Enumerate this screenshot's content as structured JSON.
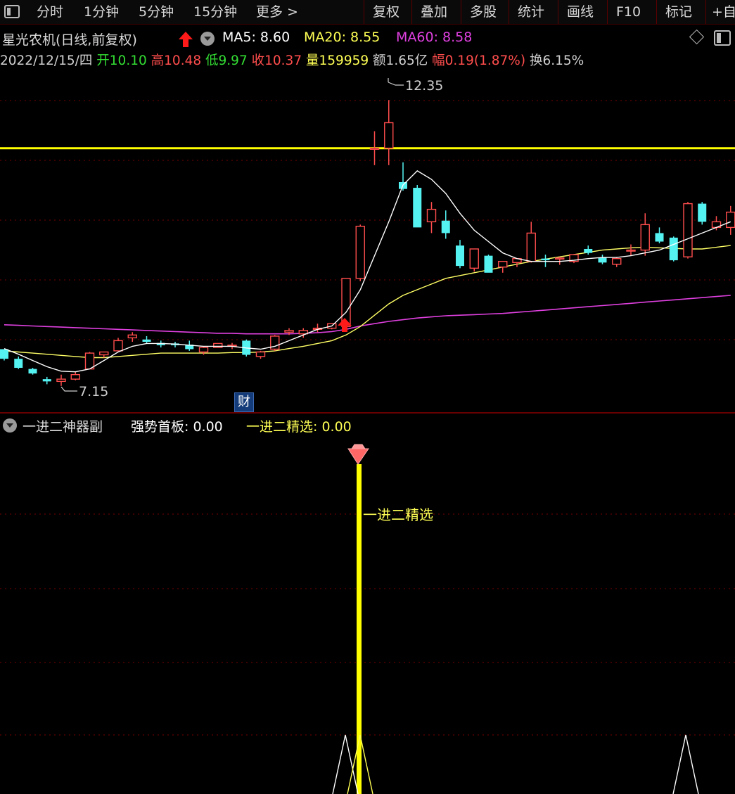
{
  "toolbar": {
    "timeframes": [
      "分时",
      "1分钟",
      "5分钟",
      "15分钟",
      "更多 >"
    ],
    "buttons": [
      "复权",
      "叠加",
      "多股",
      "统计",
      "画线",
      "F10",
      "标记",
      "+自"
    ]
  },
  "header": {
    "stock_title": "星光农机(日线,前复权)",
    "ma5_label": "MA5: 8.60",
    "ma20_label": "MA20: 8.55",
    "ma60_label": "MA60: 8.58"
  },
  "quote": {
    "date": "2022/12/15/四",
    "open_label": "开",
    "open": "10.10",
    "high_label": "高",
    "high": "10.48",
    "low_label": "低",
    "low": "9.97",
    "close_label": "收",
    "close": "10.37",
    "volume_label": "量",
    "volume": "159959",
    "amount_label": "额",
    "amount": "1.65亿",
    "change_label": "幅",
    "change": "0.19(1.87%)",
    "turnover_label": "换",
    "turnover": "6.15%"
  },
  "main_chart": {
    "high_annotation": "12.35",
    "low_annotation": "7.15",
    "finance_badge": "财",
    "resistance_price": 11.5
  },
  "indicator": {
    "name": "一进二神器副",
    "strong_label": "强势首板: 0.00",
    "select_label": "一进二精选: 0.00",
    "bar_label": "一进二精选"
  },
  "chart_data": {
    "type": "candlestick",
    "ohlc": [
      [
        7.95,
        7.9,
        7.78,
        7.75
      ],
      [
        7.78,
        7.82,
        7.62,
        7.6
      ],
      [
        7.6,
        7.62,
        7.52,
        7.5
      ],
      [
        7.42,
        7.46,
        7.38,
        7.33
      ],
      [
        7.38,
        7.5,
        7.42,
        7.3
      ],
      [
        7.42,
        7.55,
        7.5,
        7.4
      ],
      [
        7.6,
        7.9,
        7.88,
        7.6
      ],
      [
        7.85,
        7.9,
        7.9,
        7.8
      ],
      [
        7.92,
        8.15,
        8.1,
        7.92
      ],
      [
        8.15,
        8.25,
        8.2,
        8.08
      ],
      [
        8.12,
        8.18,
        8.08,
        8.05
      ],
      [
        8.06,
        8.1,
        8.02,
        7.98
      ],
      [
        8.05,
        8.08,
        8.02,
        7.98
      ],
      [
        8.03,
        8.1,
        7.95,
        7.92
      ],
      [
        7.9,
        8.0,
        7.98,
        7.85
      ],
      [
        7.98,
        8.05,
        8.05,
        7.98
      ],
      [
        8.02,
        8.06,
        8.02,
        7.95
      ],
      [
        8.1,
        8.12,
        7.85,
        7.82
      ],
      [
        7.82,
        7.92,
        7.9,
        7.78
      ],
      [
        7.95,
        8.2,
        8.18,
        7.92
      ],
      [
        8.25,
        8.32,
        8.28,
        8.2
      ],
      [
        8.22,
        8.32,
        8.28,
        8.15
      ],
      [
        8.3,
        8.4,
        8.32,
        8.25
      ],
      [
        8.32,
        8.4,
        8.4,
        8.3
      ],
      [
        8.35,
        9.2,
        9.2,
        8.32
      ],
      [
        9.2,
        10.15,
        10.12,
        9.15
      ],
      [
        11.48,
        11.8,
        11.5,
        11.2
      ],
      [
        11.5,
        12.35,
        11.95,
        11.2
      ],
      [
        10.9,
        11.25,
        10.78,
        10.75
      ],
      [
        10.8,
        10.85,
        10.1,
        10.12
      ],
      [
        10.2,
        10.55,
        10.42,
        10.0
      ],
      [
        10.22,
        10.4,
        10.0,
        9.9
      ],
      [
        9.78,
        9.88,
        9.42,
        9.38
      ],
      [
        9.38,
        9.45,
        9.72,
        9.32
      ],
      [
        9.6,
        9.62,
        9.3,
        9.32
      ],
      [
        9.4,
        9.5,
        9.5,
        9.3
      ],
      [
        9.48,
        9.55,
        9.55,
        9.4
      ],
      [
        9.5,
        10.2,
        10.0,
        9.48
      ],
      [
        9.55,
        9.62,
        9.52,
        9.4
      ],
      [
        9.56,
        9.58,
        9.56,
        9.44
      ],
      [
        9.5,
        9.62,
        9.62,
        9.47
      ],
      [
        9.72,
        9.78,
        9.65,
        9.62
      ],
      [
        9.57,
        9.62,
        9.48,
        9.45
      ],
      [
        9.45,
        9.57,
        9.55,
        9.4
      ],
      [
        9.7,
        9.8,
        9.7,
        9.6
      ],
      [
        9.7,
        10.35,
        10.15,
        9.6
      ],
      [
        10.0,
        10.1,
        9.85,
        9.82
      ],
      [
        9.92,
        9.94,
        9.52,
        9.5
      ],
      [
        9.58,
        10.55,
        10.52,
        9.55
      ],
      [
        10.52,
        10.55,
        10.2,
        10.15
      ],
      [
        10.1,
        10.3,
        10.2,
        10.05
      ],
      [
        10.1,
        10.48,
        10.37,
        9.97
      ]
    ],
    "ma5": [
      7.96,
      7.86,
      7.75,
      7.64,
      7.56,
      7.55,
      7.6,
      7.75,
      7.9,
      8.0,
      8.05,
      8.05,
      8.04,
      8.02,
      8.0,
      8.0,
      8.0,
      7.97,
      7.95,
      8.0,
      8.1,
      8.2,
      8.3,
      8.36,
      8.6,
      9.0,
      9.6,
      10.2,
      10.85,
      11.1,
      10.95,
      10.7,
      10.35,
      10.05,
      9.85,
      9.65,
      9.55,
      9.5,
      9.5,
      9.5,
      9.52,
      9.55,
      9.57,
      9.57,
      9.6,
      9.65,
      9.7,
      9.8,
      9.9,
      10.0,
      10.1,
      10.2
    ],
    "ma20": [
      7.92,
      7.9,
      7.88,
      7.86,
      7.84,
      7.82,
      7.8,
      7.8,
      7.82,
      7.84,
      7.86,
      7.88,
      7.88,
      7.88,
      7.88,
      7.88,
      7.89,
      7.89,
      7.9,
      7.92,
      7.96,
      8.0,
      8.05,
      8.1,
      8.2,
      8.35,
      8.55,
      8.75,
      8.9,
      9.0,
      9.1,
      9.2,
      9.25,
      9.3,
      9.35,
      9.4,
      9.45,
      9.5,
      9.54,
      9.58,
      9.62,
      9.66,
      9.7,
      9.72,
      9.74,
      9.75,
      9.74,
      9.73,
      9.72,
      9.72,
      9.75,
      9.78
    ],
    "ma60": [
      8.38,
      8.37,
      8.36,
      8.35,
      8.34,
      8.33,
      8.32,
      8.31,
      8.3,
      8.29,
      8.28,
      8.27,
      8.26,
      8.25,
      8.24,
      8.23,
      8.23,
      8.22,
      8.22,
      8.22,
      8.22,
      8.23,
      8.24,
      8.26,
      8.3,
      8.36,
      8.4,
      8.44,
      8.47,
      8.5,
      8.52,
      8.54,
      8.55,
      8.56,
      8.57,
      8.58,
      8.6,
      8.62,
      8.64,
      8.66,
      8.68,
      8.7,
      8.72,
      8.74,
      8.76,
      8.78,
      8.8,
      8.82,
      8.84,
      8.86,
      8.88,
      8.9
    ],
    "colors": {
      "up": "#ff4d4d",
      "down": "#55f2f2",
      "ma5": "#ffffff",
      "ma20": "#ffff66",
      "ma60": "#e040e0",
      "resistance": "#ffff00"
    }
  }
}
